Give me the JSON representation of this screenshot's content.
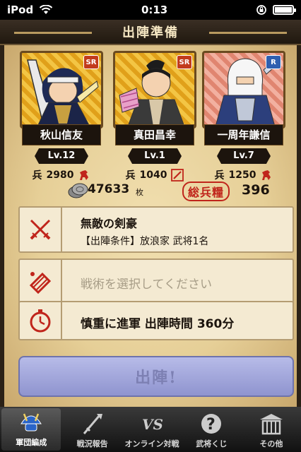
{
  "status_bar": {
    "carrier": "iPod",
    "time": "0:13"
  },
  "header": {
    "title": "出陣準備"
  },
  "cards": [
    {
      "name": "秋山信友",
      "level": "Lv.12",
      "troops": "2980",
      "rarity": "SR"
    },
    {
      "name": "真田昌幸",
      "level": "Lv.1",
      "troops": "1040",
      "rarity": "SR"
    },
    {
      "name": "一周年謙信",
      "level": "Lv.7",
      "troops": "1250",
      "rarity": "R"
    }
  ],
  "troop_label": "兵",
  "resources": {
    "coins": "47633",
    "coins_unit": "枚",
    "total_troops_label": "総兵糧",
    "total_troops": "396"
  },
  "options": {
    "formation": {
      "title": "無敵の剣豪",
      "condition": "【出陣条件】放浪家 武将1名"
    },
    "tactic": {
      "placeholder": "戦術を選択してください"
    },
    "march": {
      "label": "慎重に進軍 出陣時間 360分"
    }
  },
  "sortie_button": {
    "label": "出陣!"
  },
  "tabbar": {
    "items": [
      {
        "label": "軍団編成",
        "active": true
      },
      {
        "label": "戦況報告",
        "active": false
      },
      {
        "label": "オンライン対戦",
        "active": false
      },
      {
        "label": "武将くじ",
        "active": false
      },
      {
        "label": "その他",
        "active": false
      }
    ]
  }
}
